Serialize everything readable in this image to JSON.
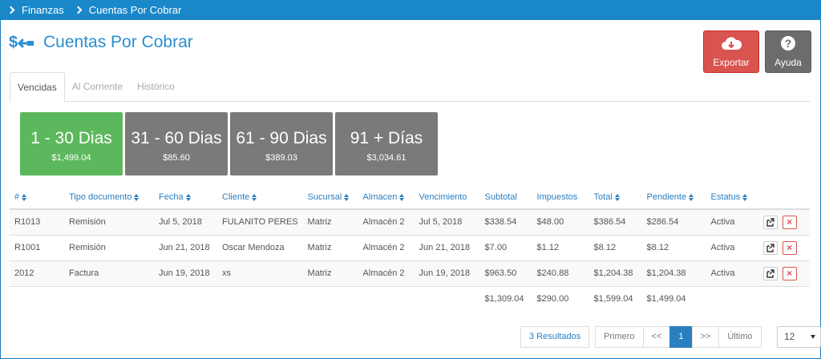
{
  "breadcrumb": [
    "Finanzas",
    "Cuentas Por Cobrar"
  ],
  "page_title": "Cuentas Por Cobrar",
  "buttons": {
    "export": "Exportar",
    "help": "Ayuda"
  },
  "tabs": [
    "Vencidas",
    "Al Corriente",
    "Histórico"
  ],
  "aging": [
    {
      "label": "1 - 30 Dias",
      "amount": "$1,499.04"
    },
    {
      "label": "31 - 60 Dias",
      "amount": "$85.60"
    },
    {
      "label": "61 - 90 Dias",
      "amount": "$389.03"
    },
    {
      "label": "91 + Días",
      "amount": "$3,034.61"
    }
  ],
  "table": {
    "headers": [
      "#",
      "Tipo documento",
      "Fecha",
      "Cliente",
      "Sucursal",
      "Almacen",
      "Vencimiento",
      "Subtotal",
      "Impuestos",
      "Total",
      "Pendiente",
      "Estatus"
    ],
    "rows": [
      [
        "R1013",
        "Remisión",
        "Jul 5, 2018",
        "FULANITO PERES",
        "Matriz",
        "Almacén 2",
        "Jul 5, 2018",
        "$338.54",
        "$48.00",
        "$386.54",
        "$286.54",
        "Activa"
      ],
      [
        "R1001",
        "Remisión",
        "Jun 21, 2018",
        "Oscar Mendoza",
        "Matriz",
        "Almacén 2",
        "Jun 21, 2018",
        "$7.00",
        "$1.12",
        "$8.12",
        "$8.12",
        "Activa"
      ],
      [
        "2012",
        "Factura",
        "Jun 19, 2018",
        "xs",
        "Matriz",
        "Almacén 2",
        "Jun 19, 2018",
        "$963.50",
        "$240.88",
        "$1,204.38",
        "$1,204.38",
        "Activa"
      ]
    ],
    "totals": {
      "subtotal": "$1,309.04",
      "impuestos": "$290.00",
      "total": "$1,599.04",
      "pendiente": "$1,499.04"
    }
  },
  "pagination": {
    "results": "3 Resultados",
    "first": "Primero",
    "prev": "<<",
    "current": "1",
    "next": ">>",
    "last": "Último"
  },
  "page_size": "12",
  "colors": {
    "topbar": "#1a87c9",
    "accent": "#2a7fc0",
    "success": "#5cb85c",
    "danger": "#d9534f",
    "neutral": "#7a7a7a"
  }
}
